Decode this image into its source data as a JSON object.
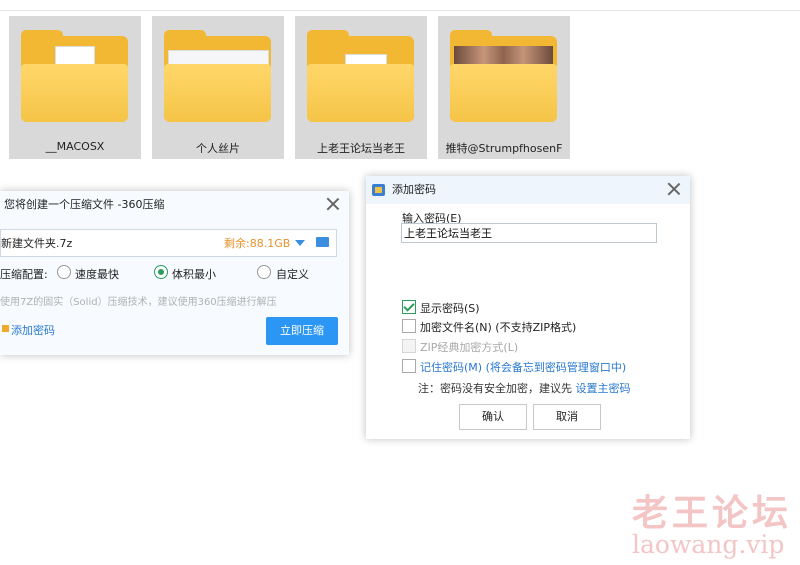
{
  "folders": [
    {
      "name": "__MACOSX",
      "preview": "document"
    },
    {
      "name": "个人丝片",
      "preview": "screenshot"
    },
    {
      "name": "上老王论坛当老王",
      "preview": "document"
    },
    {
      "name": "推特@StrumpfhosenF",
      "preview": "photo"
    }
  ],
  "compress_dialog": {
    "title": "您将创建一个压缩文件 -360压缩",
    "filename": "新建文件夹.7z",
    "free_space": "剩余:88.1GB",
    "config_label": "压缩配置:",
    "options": [
      "速度最快",
      "体积最小",
      "自定义"
    ],
    "selected_option": "体积最小",
    "hint": "使用7Z的固实（Solid）压缩技术，建议使用360压缩进行解压",
    "add_password": "添加密码",
    "compress_button": "立即压缩"
  },
  "password_dialog": {
    "title": "添加密码",
    "input_label": "输入密码(E)",
    "password_value": "上老王论坛当老王",
    "options": [
      {
        "label": "显示密码(S)",
        "checked": true,
        "disabled": false
      },
      {
        "label": "加密文件名(N) (不支持ZIP格式)",
        "checked": false,
        "disabled": false
      },
      {
        "label": "ZIP经典加密方式(L)",
        "checked": false,
        "disabled": true
      },
      {
        "label": "记住密码(M) (将会备忘到密码管理窗口中)",
        "checked": false,
        "disabled": false
      }
    ],
    "note": "注：密码没有安全加密，建议先 ",
    "note_link": "设置主密码",
    "ok": "确认",
    "cancel": "取消"
  },
  "watermark": {
    "cn": "老王论坛",
    "url": "laowang.vip"
  },
  "colors": {
    "accent": "#2b96f3",
    "folder": "#f2b834",
    "free_space": "#e8912c",
    "radio_on": "#2a9d5c"
  }
}
